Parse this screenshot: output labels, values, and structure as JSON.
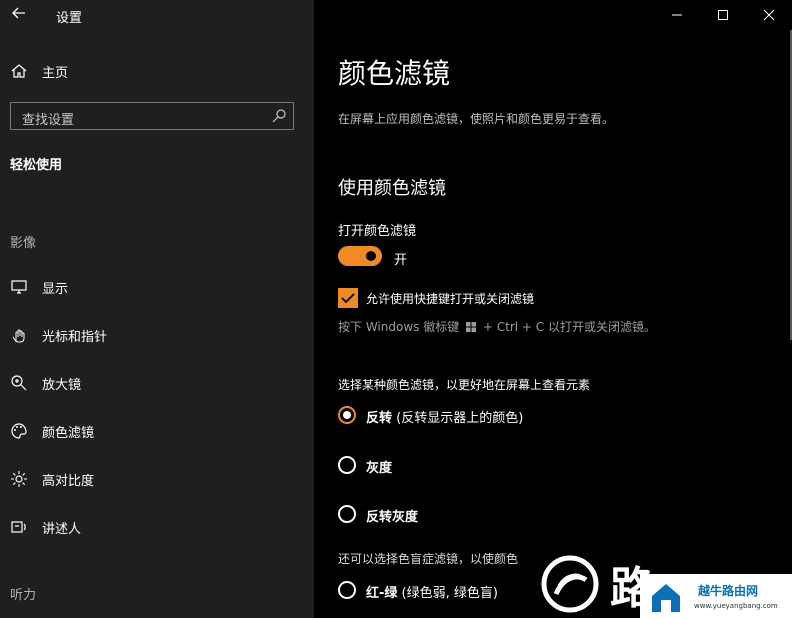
{
  "titlebar": {
    "back_label": "←",
    "title": "设置",
    "minimize": "—",
    "maximize": "☐",
    "close": "✕"
  },
  "sidebar": {
    "home_label": "主页",
    "search_placeholder": "查找设置",
    "section_title": "轻松使用",
    "group_vision": "影像",
    "items": [
      {
        "label": "显示",
        "icon": "monitor-icon"
      },
      {
        "label": "光标和指针",
        "icon": "pointer-icon"
      },
      {
        "label": "放大镜",
        "icon": "magnifier-icon"
      },
      {
        "label": "颜色滤镜",
        "icon": "palette-icon"
      },
      {
        "label": "高对比度",
        "icon": "contrast-icon"
      },
      {
        "label": "讲述人",
        "icon": "narrator-icon"
      }
    ],
    "group_hearing": "听力"
  },
  "main": {
    "title": "颜色滤镜",
    "description": "在屏幕上应用颜色滤镜，使照片和颜色更易于查看。",
    "subheading": "使用颜色滤镜",
    "toggle_label": "打开颜色滤镜",
    "toggle_state": "开",
    "toggle_on": true,
    "checkbox_label": "允许使用快捷键打开或关闭滤镜",
    "checkbox_checked": true,
    "hint_prefix": "按下 Windows 徽标键",
    "hint_suffix": "+ Ctrl + C 以打开或关闭滤镜。",
    "choose_label": "选择某种颜色滤镜，以更好地在屏幕上查看元素",
    "filters": [
      {
        "name": "反转",
        "detail": " (反转显示器上的颜色)",
        "selected": true
      },
      {
        "name": "灰度",
        "detail": "",
        "selected": false
      },
      {
        "name": "反转灰度",
        "detail": "",
        "selected": false
      }
    ],
    "more_hint": "还可以选择色盲症滤镜，以使颜色",
    "colorblind_filters": [
      {
        "name": "红-绿",
        "detail": " (绿色弱, 绿色盲)",
        "selected": false
      }
    ]
  },
  "watermark": {
    "logo_text": "路",
    "badge_title": "越牛路由网",
    "badge_url": "www.yueyangbang.com"
  },
  "colors": {
    "accent": "#f08a24",
    "sidebar_bg": "#1f1f1f",
    "main_bg": "#000000"
  }
}
